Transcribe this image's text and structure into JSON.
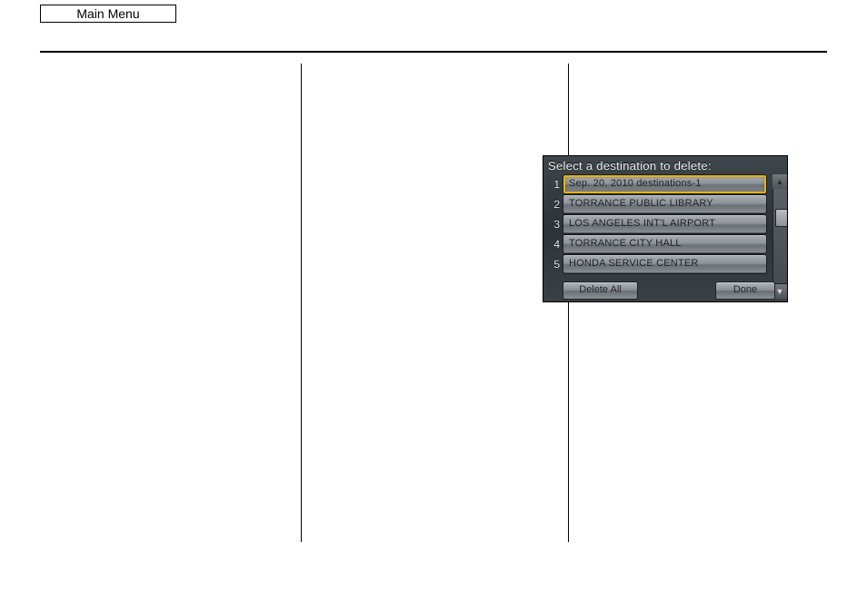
{
  "main_menu_label": "Main Menu",
  "nav": {
    "title": "Select a destination to delete:",
    "items": [
      {
        "idx": "1",
        "label": "Sep. 20, 2010 destinations-1",
        "selected": true
      },
      {
        "idx": "2",
        "label": "TORRANCE PUBLIC LIBRARY",
        "selected": false
      },
      {
        "idx": "3",
        "label": "LOS ANGELES INT'L AIRPORT",
        "selected": false
      },
      {
        "idx": "4",
        "label": "TORRANCE CITY HALL",
        "selected": false
      },
      {
        "idx": "5",
        "label": "HONDA SERVICE CENTER",
        "selected": false
      }
    ],
    "delete_all_label": "Delete All",
    "done_label": "Done",
    "scroll": {
      "up_glyph": "▲",
      "down_glyph": "▼"
    }
  }
}
